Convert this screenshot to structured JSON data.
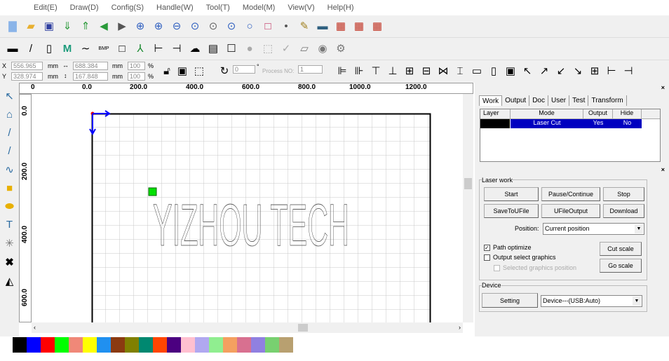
{
  "menu": [
    "Edit(E)",
    "Draw(D)",
    "Config(S)",
    "Handle(W)",
    "Tool(T)",
    "Model(M)",
    "View(V)",
    "Help(H)"
  ],
  "coords": {
    "x_label": "X",
    "y_label": "Y",
    "x": "556.965",
    "y": "328.974",
    "w": "688.384",
    "h": "167.848",
    "unit": "mm",
    "sx": "100",
    "sy": "100",
    "pct": "%",
    "rotate": "0",
    "deg": "°",
    "process_label": "Process NO:",
    "process_no": "1"
  },
  "ruler": {
    "h": [
      "0",
      "0.0",
      "200.0",
      "400.0",
      "600.0",
      "800.0",
      "1000.0",
      "1200.0"
    ],
    "v": [
      "0.0",
      "200.0",
      "400.0",
      "600.0"
    ]
  },
  "canvas": {
    "text": "YIZHOU TECH"
  },
  "tabs": [
    "Work",
    "Output",
    "Doc",
    "User",
    "Test",
    "Transform"
  ],
  "layer_table": {
    "headers": [
      "Layer",
      "Mode",
      "Output",
      "Hide"
    ],
    "rows": [
      {
        "color": "#000000",
        "mode": "Laser Cut",
        "output": "Yes",
        "hide": "No"
      }
    ]
  },
  "laser_work": {
    "title": "Laser work",
    "start": "Start",
    "pause": "Pause/Continue",
    "stop": "Stop",
    "save": "SaveToUFile",
    "ufile": "UFileOutput",
    "download": "Download",
    "position_label": "Position:",
    "position": "Current position",
    "path_optimize": "Path optimize",
    "path_optimize_checked": true,
    "output_select": "Output select graphics",
    "output_select_checked": false,
    "selected_pos": "Selected graphics position",
    "cut_scale": "Cut scale",
    "go_scale": "Go scale"
  },
  "device": {
    "title": "Device",
    "setting": "Setting",
    "device": "Device---(USB:Auto)"
  },
  "palette": [
    "#000000",
    "#0000ff",
    "#ff0000",
    "#00ff00",
    "#f08878",
    "#ffff00",
    "#2090f0",
    "#8b3a10",
    "#808000",
    "#008870",
    "#ff4500",
    "#4b0080",
    "#ffc0d0",
    "#b0a8f0",
    "#90ee90",
    "#f4a060",
    "#d87090",
    "#9080e0",
    "#78d070",
    "#b8a070"
  ]
}
